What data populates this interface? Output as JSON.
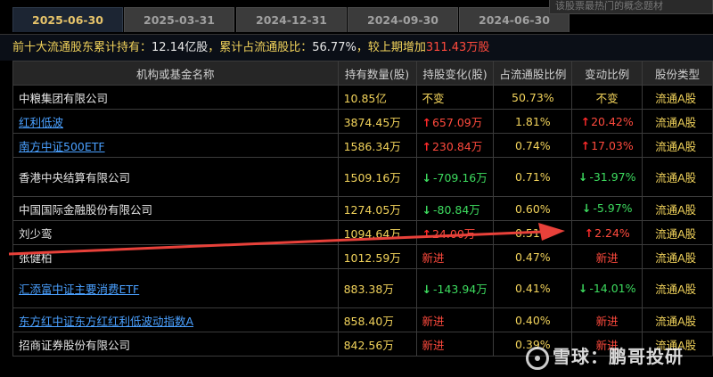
{
  "tabs": [
    {
      "label": "2025-06-30",
      "active": true
    },
    {
      "label": "2025-03-31",
      "active": false
    },
    {
      "label": "2024-12-31",
      "active": false
    },
    {
      "label": "2024-09-30",
      "active": false
    },
    {
      "label": "2024-06-30",
      "active": false
    }
  ],
  "search": {
    "placeholder": "该股票最热门的概念题材"
  },
  "summary": {
    "prefix": "前十大流通股东累计持有：",
    "held": "12.14亿股",
    "mid": "，累计占流通股比：",
    "ratio": "56.77%",
    "mid2": "，较上期增加",
    "increase": "311.43万股"
  },
  "table": {
    "headers": [
      "机构或基金名称",
      "持有数量(股)",
      "持股变化(股)",
      "占流通股比例",
      "变动比例",
      "股份类型"
    ],
    "rows": [
      {
        "name": "中粮集团有限公司",
        "link": false,
        "qty": "10.85亿",
        "change": "不变",
        "change_dir": "flat",
        "ratio": "50.73%",
        "pct": "不变",
        "pct_dir": "flat",
        "type": "流通A股"
      },
      {
        "name": "红利低波",
        "link": true,
        "qty": "3874.45万",
        "change": "657.09万",
        "change_dir": "up",
        "ratio": "1.81%",
        "pct": "20.42%",
        "pct_dir": "up",
        "type": "流通A股"
      },
      {
        "name": "南方中证500ETF",
        "link": true,
        "qty": "1586.34万",
        "change": "230.84万",
        "change_dir": "up",
        "ratio": "0.74%",
        "pct": "17.03%",
        "pct_dir": "up",
        "type": "流通A股"
      },
      {
        "name": "香港中央结算有限公司",
        "link": false,
        "qty": "1509.16万",
        "change": "-709.16万",
        "change_dir": "down",
        "ratio": "0.71%",
        "pct": "-31.97%",
        "pct_dir": "down",
        "type": "流通A股",
        "tall": true
      },
      {
        "name": "中国国际金融股份有限公司",
        "link": false,
        "qty": "1274.05万",
        "change": "-80.84万",
        "change_dir": "down",
        "ratio": "0.60%",
        "pct": "-5.97%",
        "pct_dir": "down",
        "type": "流通A股"
      },
      {
        "name": "刘少鸾",
        "link": false,
        "qty": "1094.64万",
        "change": "24.00万",
        "change_dir": "up",
        "ratio": "0.51%",
        "pct": "2.24%",
        "pct_dir": "up",
        "type": "流通A股"
      },
      {
        "name": "张健柏",
        "link": false,
        "qty": "1012.59万",
        "change": "新进",
        "change_dir": "new",
        "ratio": "0.47%",
        "pct": "新进",
        "pct_dir": "new",
        "type": "流通A股"
      },
      {
        "name": "汇添富中证主要消费ETF",
        "link": true,
        "qty": "883.38万",
        "change": "-143.94万",
        "change_dir": "down",
        "ratio": "0.41%",
        "pct": "-14.01%",
        "pct_dir": "down",
        "type": "流通A股",
        "tall": true
      },
      {
        "name": "东方红中证东方红红利低波动指数A",
        "link": true,
        "qty": "858.40万",
        "change": "新进",
        "change_dir": "new",
        "ratio": "0.40%",
        "pct": "新进",
        "pct_dir": "new",
        "type": "流通A股"
      },
      {
        "name": "招商证券股份有限公司",
        "link": false,
        "qty": "842.56万",
        "change": "新进",
        "change_dir": "new",
        "ratio": "0.39%",
        "pct": "新进",
        "pct_dir": "new",
        "type": "流通A股"
      }
    ]
  },
  "watermark": {
    "text": "雪球：鹏哥投研"
  },
  "colors": {
    "gold": "#f2d35b",
    "red": "#ff4a3d",
    "green": "#3ddc5f",
    "link": "#4aa0ff"
  }
}
